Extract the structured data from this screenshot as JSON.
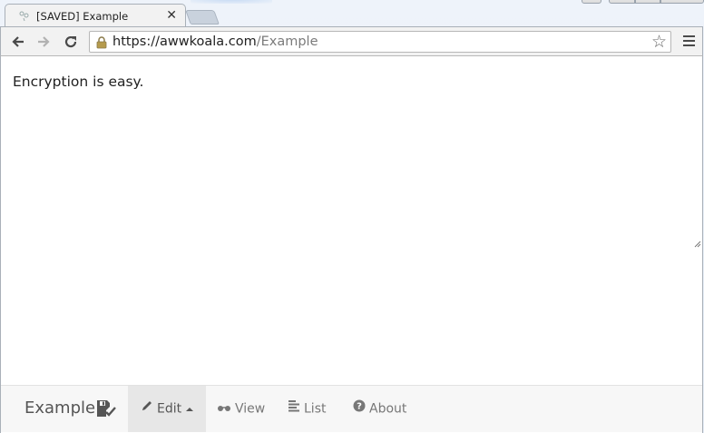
{
  "browser": {
    "tab": {
      "title": "[SAVED] Example",
      "close_glyph": "✕",
      "favicon": "default-page-icon"
    },
    "toolbar": {
      "back_glyph": "←",
      "forward_glyph": "→",
      "reload_glyph": "↻",
      "url_host": "https://awwkoala.com",
      "url_path": "/Example",
      "star_glyph": "☆"
    }
  },
  "page": {
    "editor_text": "Encryption is easy."
  },
  "navbar": {
    "brand": "Example",
    "items": [
      {
        "label": "Edit",
        "icon": "pencil-icon",
        "active": true
      },
      {
        "label": "View",
        "icon": "eyeglasses-icon",
        "active": false
      },
      {
        "label": "List",
        "icon": "align-left-icon",
        "active": false
      },
      {
        "label": "About",
        "icon": "question-circle-icon",
        "active": false
      }
    ]
  },
  "colors": {
    "active_nav_bg": "#e7e7e7",
    "nav_text": "#777777",
    "url_path": "#7b7b7b"
  }
}
